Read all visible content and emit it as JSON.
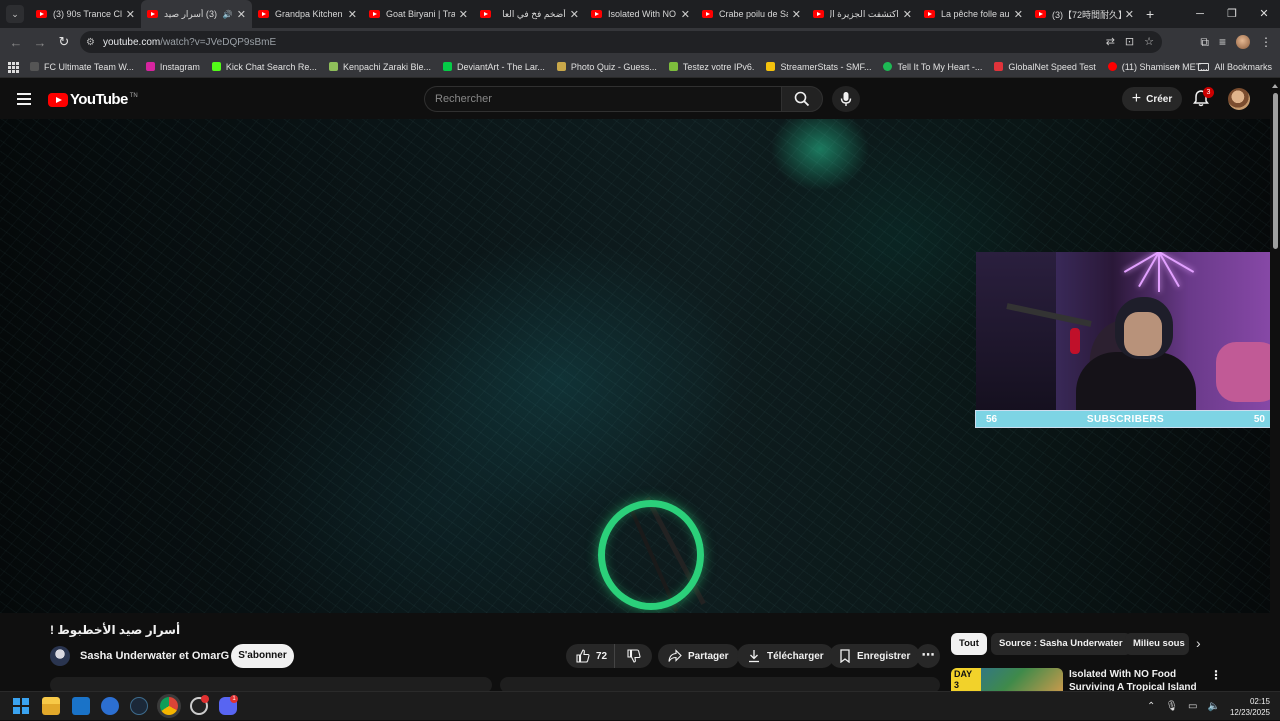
{
  "browser": {
    "tabs": [
      {
        "title": "(3) 90s Trance Cla",
        "active": false
      },
      {
        "title": "(3) أسرار صيد",
        "active": true,
        "audio": true
      },
      {
        "title": "Grandpa Kitchen",
        "active": false
      },
      {
        "title": "Goat Biryani | Tra",
        "active": false
      },
      {
        "title": "أضخم فخ في العا",
        "active": false
      },
      {
        "title": "Isolated With NO",
        "active": false
      },
      {
        "title": "Crabe poilu de Sa",
        "active": false
      },
      {
        "title": "اكتشفت الجزيرة ال",
        "active": false
      },
      {
        "title": "La pêche folle au",
        "active": false
      },
      {
        "title": "(3)【72時間耐久】",
        "active": false
      }
    ],
    "url_domain": "youtube.com",
    "url_path": "/watch?v=JVeDQP9sBmE",
    "bookmarks": [
      {
        "label": "FC Ultimate Team W...",
        "color": "#555555"
      },
      {
        "label": "Instagram",
        "color": "#d6249f"
      },
      {
        "label": "Kick Chat Search Re...",
        "color": "#53fc18"
      },
      {
        "label": "Kenpachi Zaraki Ble...",
        "color": "#8fbf5a"
      },
      {
        "label": "DeviantArt - The Lar...",
        "color": "#05cc47"
      },
      {
        "label": "Photo Quiz - Guess...",
        "color": "#c9a84a"
      },
      {
        "label": "Testez votre IPv6.",
        "color": "#7dbd3c"
      },
      {
        "label": "StreamerStats - SMF...",
        "color": "#f4c20d"
      },
      {
        "label": "Tell It To My Heart -...",
        "color": "#1db954"
      },
      {
        "label": "GlobalNet Speed Test",
        "color": "#e0333a"
      },
      {
        "label": "(11) Shamisen MET...",
        "color": "#ff0000"
      }
    ],
    "all_bookmarks_label": "All Bookmarks"
  },
  "youtube": {
    "logo_text": "YouTube",
    "logo_tm": "TN",
    "search_placeholder": "Rechercher",
    "create_label": "Créer",
    "notification_count": "3"
  },
  "stream_overlay": {
    "left_number": "56",
    "label": "SUBSCRIBERS",
    "right_number": "50"
  },
  "video": {
    "title": "أسرار صيد الأخطبوط !",
    "channel": "Sasha Underwater et OmarG",
    "subscribe_label": "S'abonner",
    "likes": "72",
    "share_label": "Partager",
    "download_label": "Télécharger",
    "save_label": "Enregistrer"
  },
  "recommendations": {
    "chips": [
      {
        "label": "Tout",
        "active": true
      },
      {
        "label": "Source : Sasha Underwater",
        "active": false
      },
      {
        "label": "Milieu sous",
        "active": false
      }
    ],
    "first_title": "Isolated With NO Food Surviving A Tropical Island",
    "first_badge": "DAY 3"
  },
  "taskbar": {
    "time": "02:15",
    "date": "12/23/2025",
    "discord_badge": "1"
  },
  "colors": {
    "youtube_red": "#ff0000",
    "overlay_bar": "#7dd4e4",
    "lure_green": "#2bd07a"
  }
}
